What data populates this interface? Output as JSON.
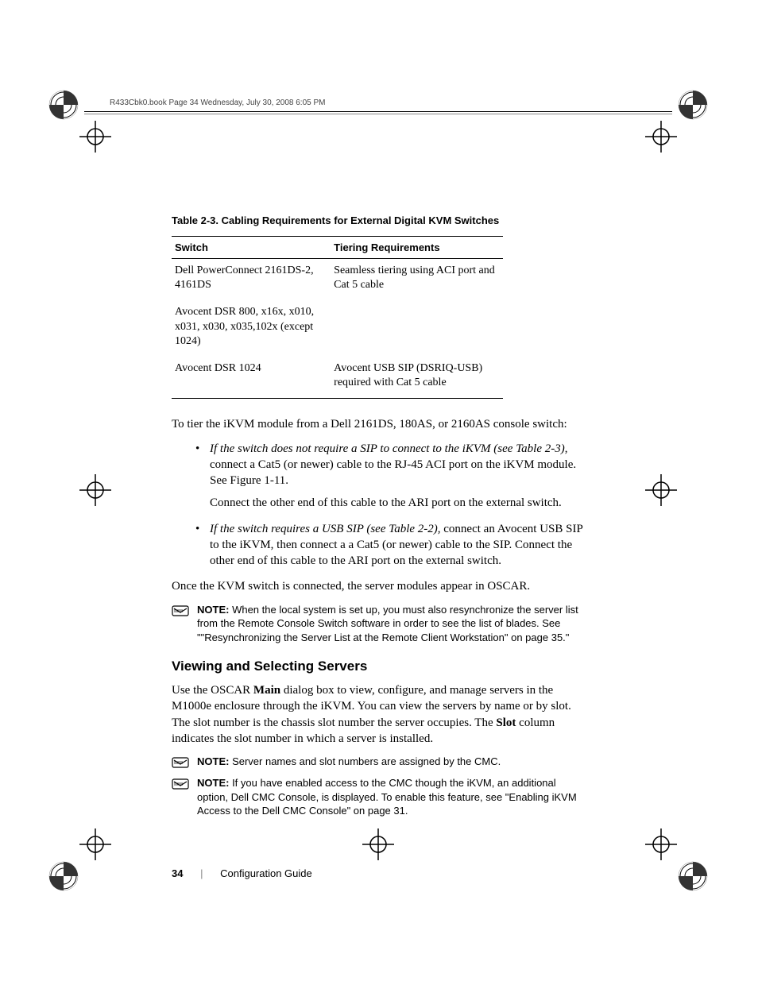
{
  "header_line": "R433Cbk0.book  Page 34  Wednesday, July 30, 2008  6:05 PM",
  "table": {
    "caption": "Table 2-3.    Cabling Requirements for External Digital KVM Switches",
    "headers": [
      "Switch",
      "Tiering Requirements"
    ],
    "rows": [
      {
        "switch": "Dell PowerConnect 2161DS-2, 4161DS",
        "req": "Seamless tiering using ACI port and Cat 5 cable"
      },
      {
        "switch": "Avocent DSR 800, x16x, x010, x031, x030, x035,102x (except 1024)",
        "req": ""
      },
      {
        "switch": "Avocent DSR 1024",
        "req": "Avocent USB SIP (DSRIQ-USB) required with Cat 5 cable"
      }
    ]
  },
  "intro": "To tier the iKVM module from a Dell 2161DS, 180AS, or 2160AS console switch:",
  "bullets": [
    {
      "lead_italic": "If the switch does not require a SIP to connect to the iKVM (see Table 2-3)",
      "rest": ", connect a Cat5 (or newer) cable to the RJ-45 ACI port on the iKVM module. See Figure 1-11.",
      "sub": "Connect the other end of this cable to the ARI port on the external switch."
    },
    {
      "lead_italic": "If the switch requires a USB SIP (see Table 2-2),",
      "rest": " connect an Avocent USB SIP to the iKVM, then connect a a Cat5 (or newer) cable to the SIP. Connect the other end of this cable to the ARI port on the external switch.",
      "sub": ""
    }
  ],
  "after_list": "Once the KVM switch is connected, the server modules appear in OSCAR.",
  "note1": {
    "label": "NOTE:",
    "text": " When the local system is set up, you must also resynchronize the server list from the Remote Console Switch software in order to see the list of blades. See \"\"Resynchronizing the Server List at the Remote Client Workstation\" on page 35.\""
  },
  "heading": "Viewing and Selecting Servers",
  "section_para_pre": "Use the OSCAR ",
  "section_para_bold1": "Main",
  "section_para_mid": " dialog box to view, configure, and manage servers in the M1000e enclosure through the iKVM. You can view the servers by name or by slot. The slot number is the chassis slot number the server occupies. The ",
  "section_para_bold2": "Slot",
  "section_para_post": " column indicates the slot number in which a server is installed.",
  "note2": {
    "label": "NOTE:",
    "text": " Server names and slot numbers are assigned by the CMC."
  },
  "note3": {
    "label": "NOTE:",
    "text": " If you have enabled access to the CMC though the iKVM, an additional option, Dell CMC Console, is displayed. To enable this feature, see \"Enabling iKVM Access to the Dell CMC Console\" on page 31."
  },
  "footer": {
    "page": "34",
    "title": "Configuration Guide"
  }
}
